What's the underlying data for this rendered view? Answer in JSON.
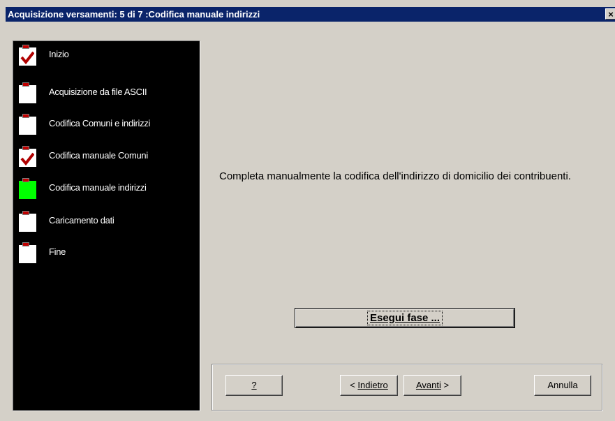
{
  "window": {
    "title": "Acquisizione versamenti: 5 di 7 :Codifica manuale indirizzi",
    "close_glyph": "×"
  },
  "steps": [
    {
      "label": "Inizio",
      "state": "done"
    },
    {
      "label": "Acquisizione da file ASCII",
      "state": "pending"
    },
    {
      "label": "Codifica Comuni e indirizzi",
      "state": "pending"
    },
    {
      "label": "Codifica manuale Comuni",
      "state": "done"
    },
    {
      "label": "Codifica manuale indirizzi",
      "state": "current"
    },
    {
      "label": "Caricamento dati",
      "state": "pending"
    },
    {
      "label": "Fine",
      "state": "pending"
    }
  ],
  "description": "Completa manualmente la codifica dell'indirizzo di domicilio dei contribuenti.",
  "execute_button": {
    "label": "Esegui fase ..."
  },
  "buttons": {
    "help": "?",
    "back_prefix": "< ",
    "back": "Indietro",
    "next": "Avanti",
    "next_suffix": " >",
    "cancel": "Annulla"
  },
  "colors": {
    "titlebar": "#0a246a",
    "panel": "#000000",
    "current_step": "#00ff00",
    "check": "#b00000",
    "dialog": "#d4d0c8"
  }
}
